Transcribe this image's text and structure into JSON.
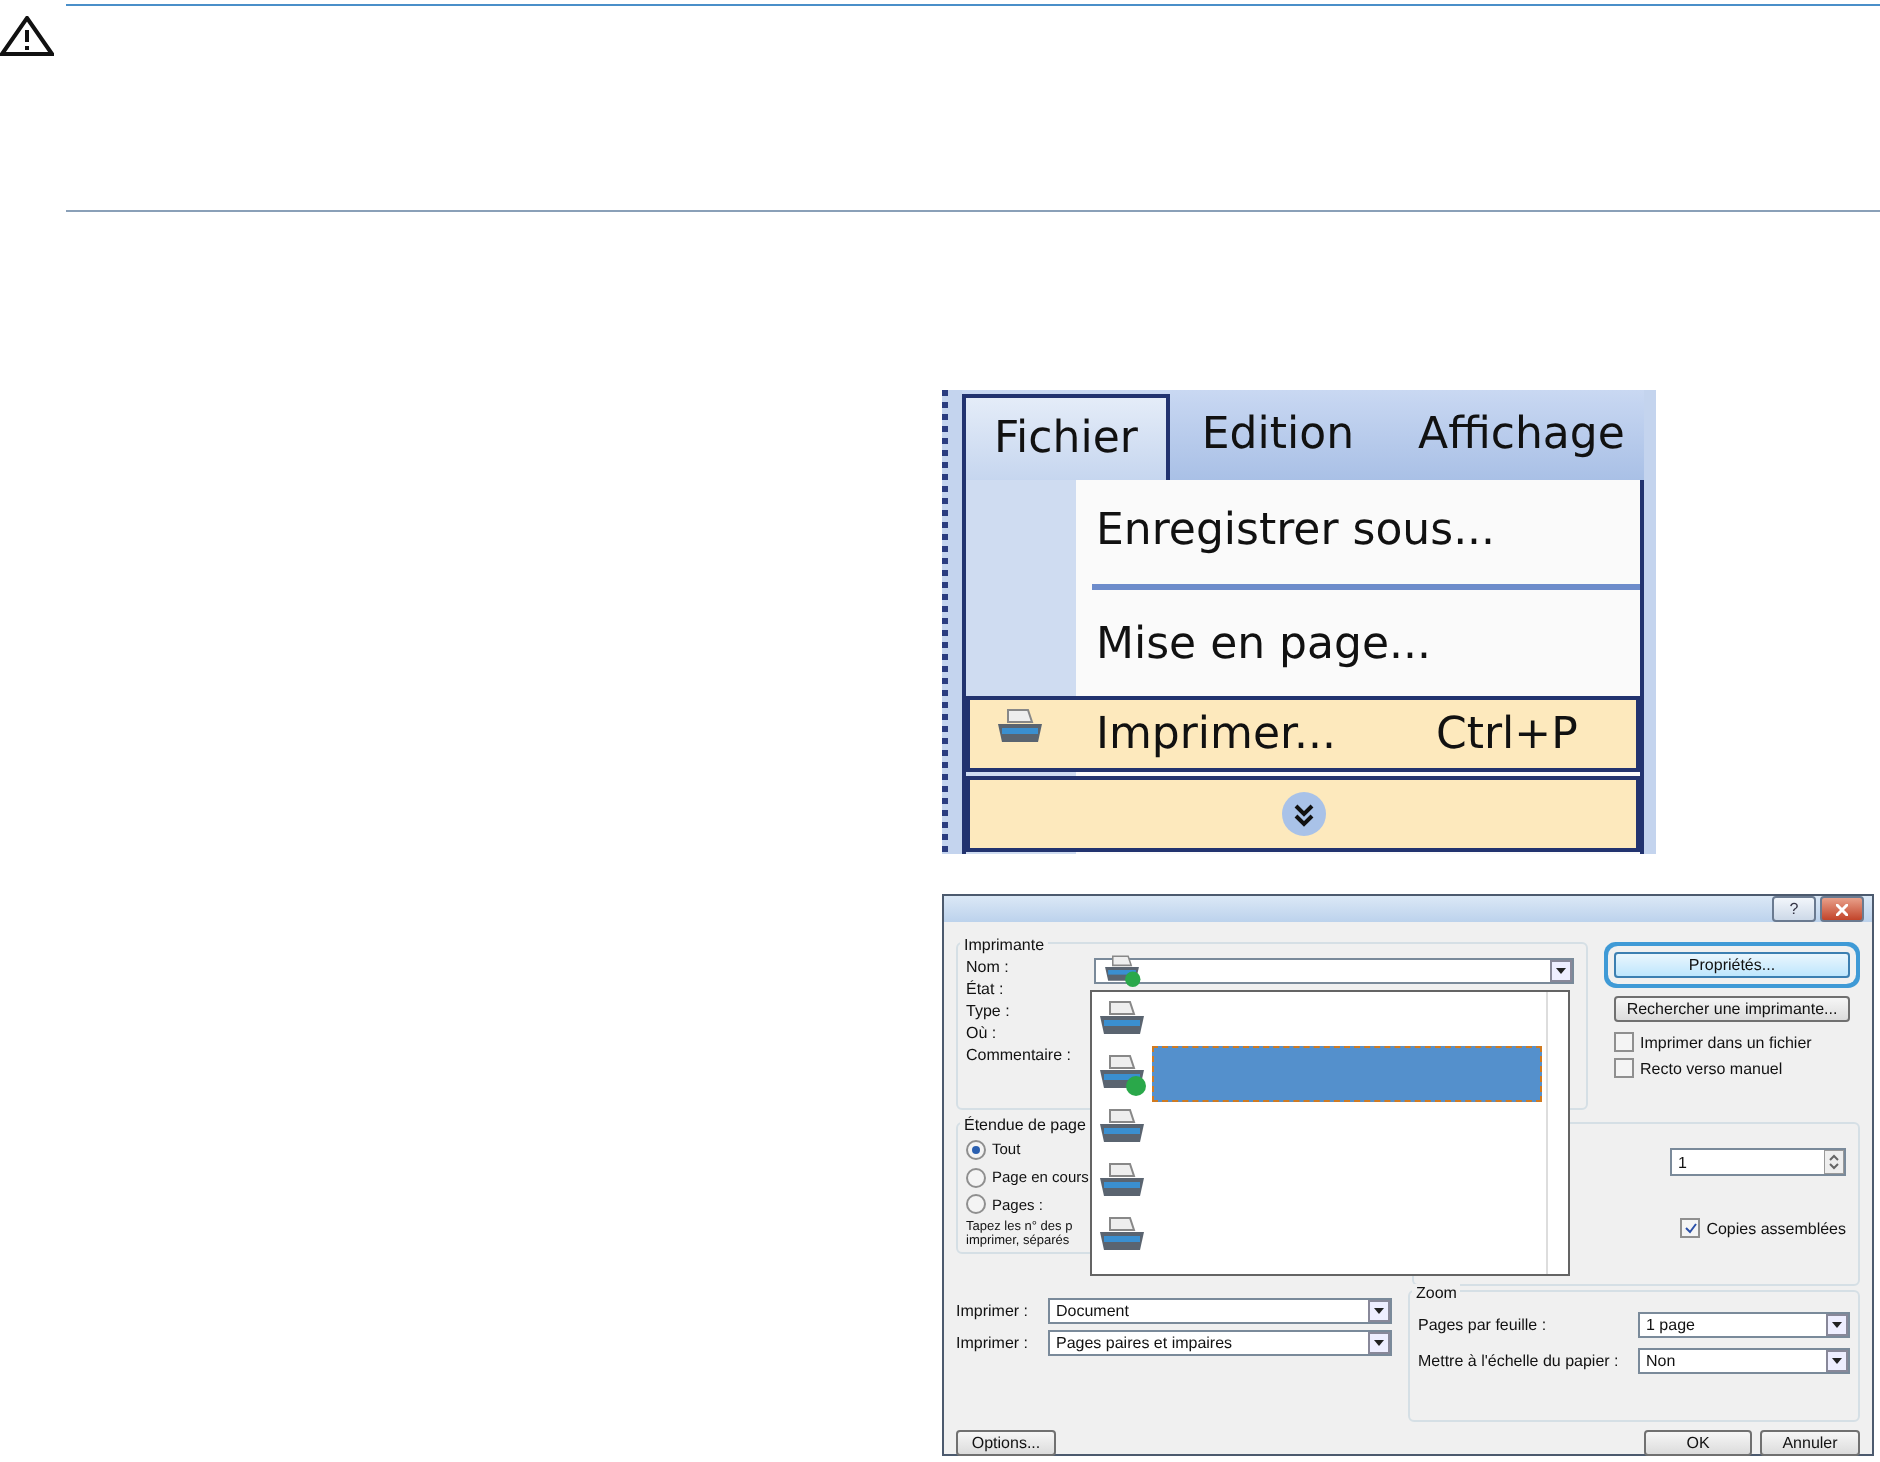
{
  "menu": {
    "menubar": [
      {
        "label": "Fichier",
        "selected": true
      },
      {
        "label": "Edition",
        "selected": false
      },
      {
        "label": "Affichage",
        "selected": false
      }
    ],
    "items": [
      {
        "kind": "item",
        "label": "Enregistrer sous...",
        "highlighted": false
      },
      {
        "kind": "separator"
      },
      {
        "kind": "item",
        "label": "Mise en page...",
        "highlighted": false
      },
      {
        "kind": "icon_item",
        "label": "Imprimer...",
        "shortcut": "Ctrl+P",
        "highlighted": true
      },
      {
        "kind": "expand",
        "highlighted": true
      }
    ]
  },
  "dialog": {
    "help": "?",
    "printer_group": {
      "title": "Imprimante",
      "fields": [
        {
          "label": "Nom :"
        },
        {
          "label": "État :"
        },
        {
          "label": "Type :"
        },
        {
          "label": "Où :"
        },
        {
          "label": "Commentaire :"
        }
      ]
    },
    "printer_list": [
      {
        "selected": false,
        "default": false
      },
      {
        "selected": true,
        "default": true
      },
      {
        "selected": false,
        "default": false
      },
      {
        "selected": false,
        "default": false
      },
      {
        "selected": false,
        "default": false
      }
    ],
    "buttons": [
      {
        "label": "Propriétés...",
        "focused": true
      },
      {
        "label": "Rechercher une imprimante...",
        "focused": false
      }
    ],
    "checkboxes": [
      {
        "label": "Imprimer dans un fichier",
        "checked": false
      },
      {
        "label": "Recto verso manuel",
        "checked": false
      }
    ],
    "range": {
      "title": "Étendue de page",
      "radios": [
        {
          "label": "Tout",
          "selected": true
        },
        {
          "label": "Page en cours",
          "selected": false
        },
        {
          "label": "Pages :",
          "selected": false
        }
      ],
      "hint": [
        "Tapez les n° des p",
        "imprimer, séparés"
      ]
    },
    "copies": {
      "value": "1",
      "collate": {
        "label": "Copies assemblées",
        "checked": true
      }
    },
    "print_selects": [
      {
        "label": "Imprimer :",
        "value": "Document"
      },
      {
        "label": "Imprimer :",
        "value": "Pages paires et impaires"
      }
    ],
    "zoom": {
      "title": "Zoom",
      "selects": [
        {
          "label": "Pages par feuille :",
          "value": "1 page"
        },
        {
          "label": "Mettre à l'échelle du papier :",
          "value": "Non"
        }
      ]
    },
    "footer": {
      "options": "Options...",
      "ok": "OK",
      "cancel": "Annuler"
    }
  }
}
